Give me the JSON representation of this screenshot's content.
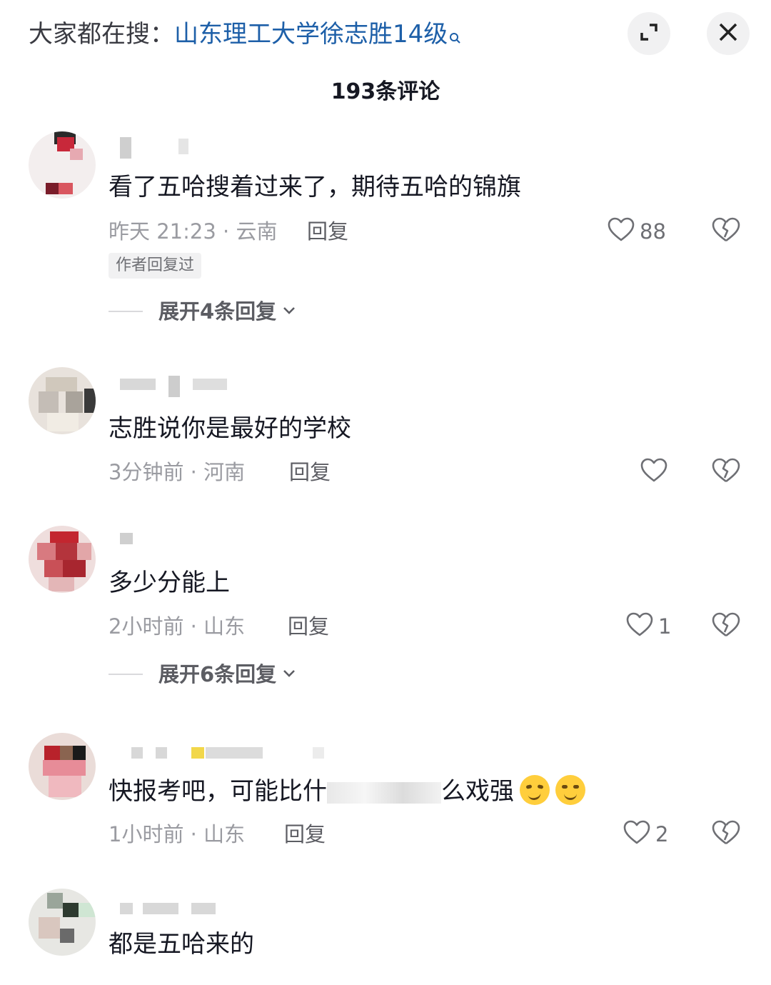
{
  "header": {
    "search_prefix": "大家都在搜：",
    "search_term": "山东理工大学徐志胜14级",
    "comment_count": "193条评论"
  },
  "comments": [
    {
      "text": "看了五哈搜着过来了，期待五哈的锦旗",
      "time_location": "昨天 21:23 · 云南",
      "reply": "回复",
      "likes": "88",
      "author_tag": "作者回复过",
      "expand": "展开4条回复"
    },
    {
      "text": "志胜说你是最好的学校",
      "time_location": "3分钟前 · 河南",
      "reply": "回复",
      "likes": ""
    },
    {
      "text": "多少分能上",
      "time_location": "2小时前 · 山东",
      "reply": "回复",
      "likes": "1",
      "expand": "展开6条回复"
    },
    {
      "text_start": "快报考吧，可能比什",
      "text_end": "么戏强",
      "time_location": "1小时前 · 山东",
      "reply": "回复",
      "likes": "2"
    },
    {
      "text": "都是五哈来的"
    }
  ],
  "icons": {
    "expand": "expand-icon",
    "close": "close-icon",
    "like": "heart-outline-icon",
    "dislike": "broken-heart-icon",
    "chevron": "chevron-down-icon"
  }
}
